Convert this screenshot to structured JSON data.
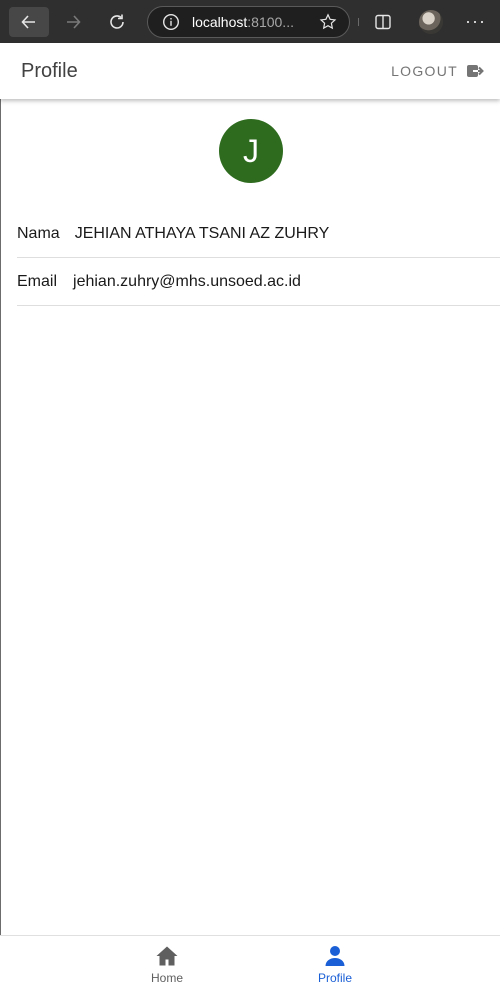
{
  "browser": {
    "url_host": "localhost",
    "url_rest": ":8100...",
    "icons": [
      "back-arrow-icon",
      "forward-arrow-icon",
      "reload-icon",
      "info-icon",
      "star-icon",
      "split-screen-icon",
      "profile-avatar-icon",
      "more-icon"
    ]
  },
  "header": {
    "title": "Profile",
    "logout_label": "LOGOUT",
    "logout_icon": "logout-icon"
  },
  "profile": {
    "avatar_initial": "J",
    "avatar_color": "#2e6b1f",
    "fields": [
      {
        "label": "Nama",
        "value": "JEHIAN ATHAYA TSANI AZ ZUHRY"
      },
      {
        "label": "Email",
        "value": "jehian.zuhry@mhs.unsoed.ac.id"
      }
    ]
  },
  "tabs": [
    {
      "label": "Home",
      "icon": "home-icon",
      "active": false
    },
    {
      "label": "Profile",
      "icon": "person-icon",
      "active": true
    }
  ],
  "colors": {
    "active_tab": "#1a5fd6",
    "inactive_tab": "#5f5f5f"
  }
}
